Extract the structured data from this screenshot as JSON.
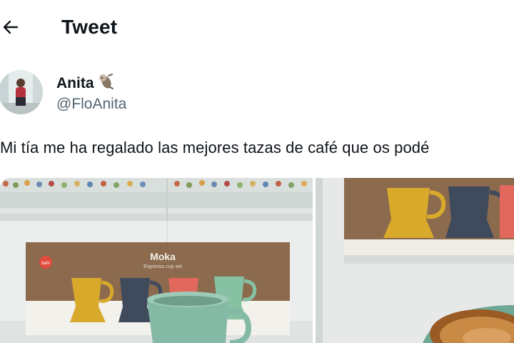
{
  "header": {
    "title": "Tweet",
    "back_icon": "arrow-left-icon"
  },
  "author": {
    "display_name": "Anita",
    "emoji_icon": "sloth-emoji-icon",
    "handle": "@FloAnita"
  },
  "tweet": {
    "text": "Mi tía me ha regalado las mejores tazas de café que os podé"
  },
  "media": [
    {
      "box_brand": "Moka",
      "box_subtitle": "Espresso cup set",
      "box_logo": "bahi"
    },
    {
      "content": "coffee-cup-closeup"
    }
  ],
  "colors": {
    "text": "#0f1419",
    "secondary": "#536471",
    "cup_yellow": "#d9a92c",
    "cup_navy": "#3f4a5c",
    "cup_coral": "#e2675d",
    "cup_mint": "#86c1a3"
  }
}
